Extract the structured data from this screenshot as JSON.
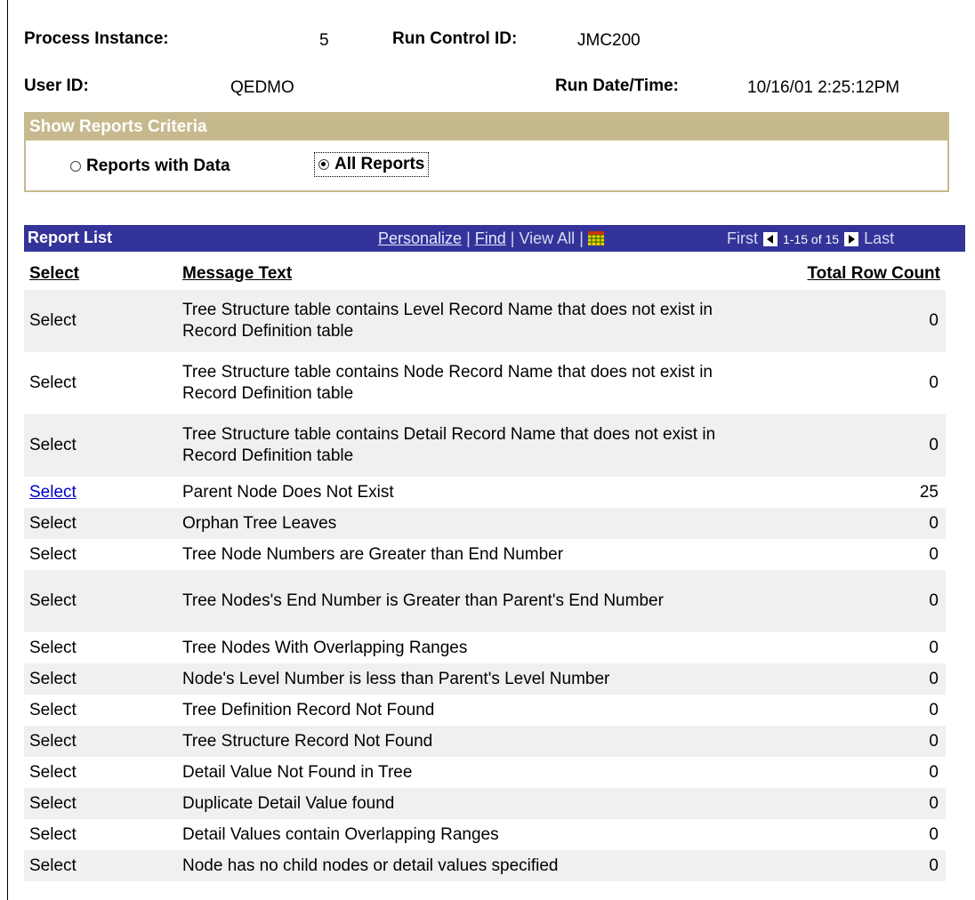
{
  "header": {
    "process_instance_label": "Process Instance:",
    "process_instance_value": "5",
    "run_control_label": "Run Control ID:",
    "run_control_value": "JMC200",
    "user_id_label": "User ID:",
    "user_id_value": "QEDMO",
    "run_datetime_label": "Run Date/Time:",
    "run_datetime_value": "10/16/01 2:25:12PM"
  },
  "criteria": {
    "title": "Show Reports Criteria",
    "option_with_data": "Reports with Data",
    "option_all": "All Reports",
    "selected": "All Reports"
  },
  "report_list": {
    "title": "Report List",
    "personalize": "Personalize",
    "find": "Find",
    "view_all": "View All",
    "first": "First",
    "count": "1-15 of 15",
    "last": "Last",
    "columns": [
      "Select",
      "Message Text",
      "Total Row Count"
    ],
    "rows": [
      {
        "select": "Select",
        "message": "Tree Structure table contains Level Record Name that does not exist in Record Definition table",
        "count": "0"
      },
      {
        "select": "Select",
        "message": "Tree Structure table contains Node Record Name that does not exist in Record Definition table",
        "count": "0"
      },
      {
        "select": "Select",
        "message": "Tree Structure table contains Detail Record Name that does not exist in Record Definition table",
        "count": "0"
      },
      {
        "select": "Select",
        "message": "Parent Node Does Not Exist",
        "count": "25",
        "link": true
      },
      {
        "select": "Select",
        "message": "Orphan Tree Leaves",
        "count": "0"
      },
      {
        "select": "Select",
        "message": "Tree Node Numbers are Greater than End Number",
        "count": "0"
      },
      {
        "select": "Select",
        "message": "Tree Nodes's End Number is Greater than Parent's End Number",
        "count": "0"
      },
      {
        "select": "Select",
        "message": "Tree Nodes With Overlapping Ranges",
        "count": "0"
      },
      {
        "select": "Select",
        "message": "Node's Level Number is less than Parent's Level Number",
        "count": "0"
      },
      {
        "select": "Select",
        "message": "Tree Definition Record Not Found",
        "count": "0"
      },
      {
        "select": "Select",
        "message": "Tree Structure Record Not Found",
        "count": "0"
      },
      {
        "select": "Select",
        "message": "Detail Value Not Found in Tree",
        "count": "0"
      },
      {
        "select": "Select",
        "message": "Duplicate Detail Value found",
        "count": "0"
      },
      {
        "select": "Select",
        "message": "Detail Values contain Overlapping Ranges",
        "count": "0"
      },
      {
        "select": "Select",
        "message": "Node has no child nodes or detail values specified",
        "count": "0"
      }
    ]
  },
  "colors": {
    "criteria_bar": "#c7b98e",
    "grid_header": "#333399",
    "link": "#0000cc",
    "row_stripe": "#f0f0f0"
  },
  "icons": [
    "grid-download-icon",
    "prev-arrow-icon",
    "next-arrow-icon"
  ]
}
